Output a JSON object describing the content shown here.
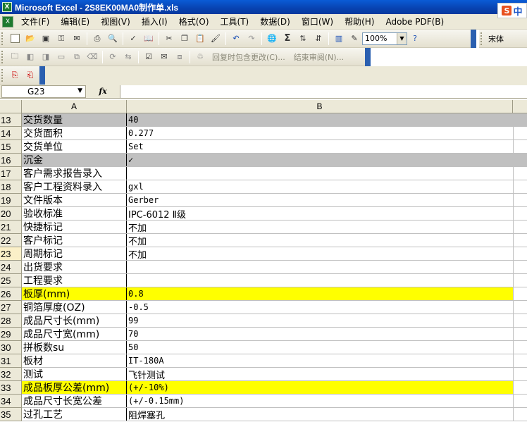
{
  "window": {
    "title": "Microsoft Excel - 2S8EK00MA0制作单.xls",
    "app_icon": "excel-icon"
  },
  "ime": {
    "logo": "S",
    "label": "中"
  },
  "menu": [
    {
      "label": "文件(F)"
    },
    {
      "label": "编辑(E)"
    },
    {
      "label": "视图(V)"
    },
    {
      "label": "插入(I)"
    },
    {
      "label": "格式(O)"
    },
    {
      "label": "工具(T)"
    },
    {
      "label": "数据(D)"
    },
    {
      "label": "窗口(W)"
    },
    {
      "label": "帮助(H)"
    },
    {
      "label": "Adobe PDF(B)"
    }
  ],
  "toolbar": {
    "zoom": "100%",
    "font": "宋体",
    "sigma": "Σ"
  },
  "review_toolbar": {
    "reply_changes": "回复时包含更改(C)...",
    "end_review": "结束审阅(N)..."
  },
  "formula_bar": {
    "cell_ref": "G23",
    "fx": "fx",
    "content": ""
  },
  "columns": [
    {
      "label": "A"
    },
    {
      "label": "B"
    }
  ],
  "rows": [
    {
      "num": "13",
      "a": "交货数量",
      "b": "40",
      "style": "gray"
    },
    {
      "num": "14",
      "a": "交货面积",
      "b": "0.277",
      "style": ""
    },
    {
      "num": "15",
      "a": "交货单位",
      "b": "Set",
      "style": ""
    },
    {
      "num": "16",
      "a": "沉金",
      "b": "✓",
      "style": "gray"
    },
    {
      "num": "17",
      "a": "客户需求报告录入",
      "b": "",
      "style": ""
    },
    {
      "num": "18",
      "a": "客户工程资料录入",
      "b": "gxl",
      "style": ""
    },
    {
      "num": "19",
      "a": "文件版本",
      "b": "Gerber",
      "style": ""
    },
    {
      "num": "20",
      "a": "验收标准",
      "b": "IPC-6012 Ⅱ级",
      "style": ""
    },
    {
      "num": "21",
      "a": "快捷标记",
      "b": "不加",
      "style": ""
    },
    {
      "num": "22",
      "a": "客户标记",
      "b": "不加",
      "style": ""
    },
    {
      "num": "23",
      "a": "周期标记",
      "b": "不加",
      "style": ""
    },
    {
      "num": "24",
      "a": "出货要求",
      "b": "",
      "style": ""
    },
    {
      "num": "25",
      "a": "工程要求",
      "b": "",
      "style": ""
    },
    {
      "num": "26",
      "a": "板厚(mm)",
      "b": "0.8",
      "style": "yellow"
    },
    {
      "num": "27",
      "a": "铜箔厚度(OZ)",
      "b": "-0.5",
      "style": ""
    },
    {
      "num": "28",
      "a": "成品尺寸长(mm)",
      "b": "99",
      "style": ""
    },
    {
      "num": "29",
      "a": "成品尺寸宽(mm)",
      "b": "70",
      "style": ""
    },
    {
      "num": "30",
      "a": "拼板数su",
      "b": "50",
      "style": ""
    },
    {
      "num": "31",
      "a": "板材",
      "b": "IT-180A",
      "style": ""
    },
    {
      "num": "32",
      "a": "测试",
      "b": "飞针测试",
      "style": ""
    },
    {
      "num": "33",
      "a": "成品板厚公差(mm)",
      "b": "(+/-10%)",
      "style": "yellow"
    },
    {
      "num": "34",
      "a": "成品尺寸长宽公差",
      "b": "(+/-0.15mm)",
      "style": ""
    },
    {
      "num": "35",
      "a": "过孔工艺",
      "b": "阻焊塞孔",
      "style": ""
    }
  ],
  "colors": {
    "header_bg": "#ece9d8",
    "highlight_yellow": "#ffff00",
    "highlight_gray": "#c0c0c0",
    "title_blue": "#0a5bd6"
  }
}
